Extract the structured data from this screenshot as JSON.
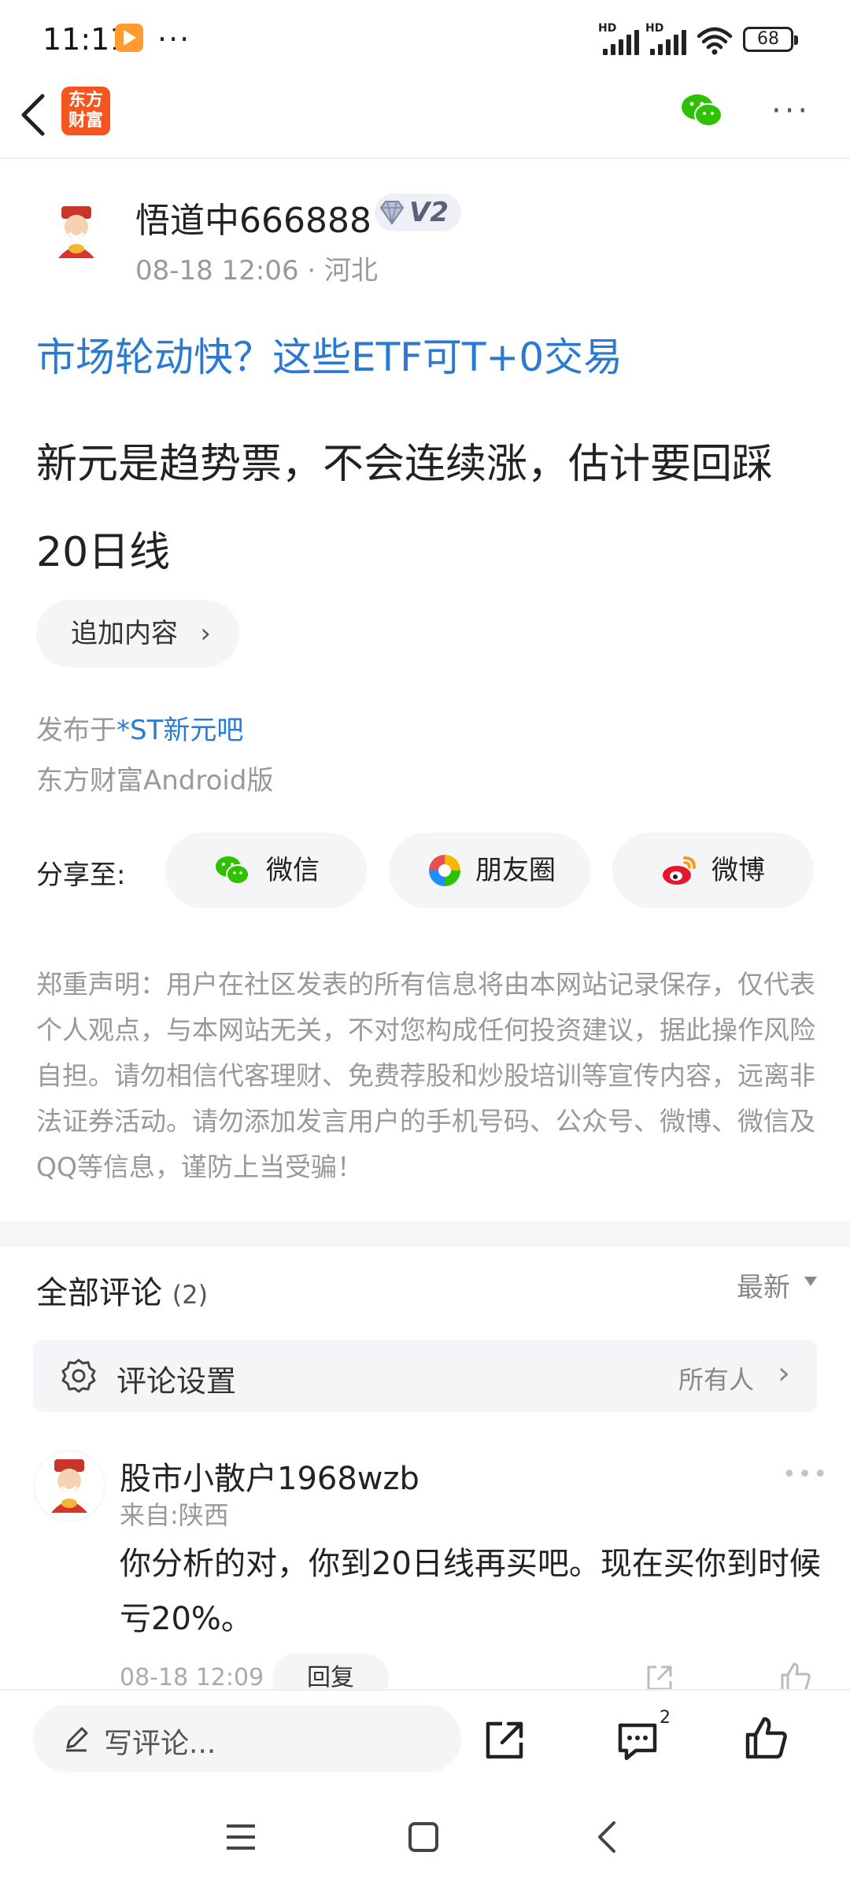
{
  "status_bar": {
    "time": "11:11",
    "overflow_dots": "···",
    "hd1": "HD",
    "hd2": "HD",
    "battery": "68"
  },
  "nav": {
    "logo_line1": "东方",
    "logo_line2": "财富",
    "more": "···"
  },
  "post": {
    "author": "悟道中666888",
    "badge": "V2",
    "meta": "08-18 12:06 · 河北",
    "title": "市场轮动快？这些ETF可T+0交易",
    "content": "新元是趋势票，不会连续涨，估计要回踩20日线",
    "append_label": "追加内容",
    "published_prefix": "发布于",
    "board": "*ST新元吧",
    "client": "东方财富Android版"
  },
  "share": {
    "label": "分享至:",
    "wechat": "微信",
    "moments": "朋友圈",
    "weibo": "微博"
  },
  "disclaimer": "郑重声明：用户在社区发表的所有信息将由本网站记录保存，仅代表个人观点，与本网站无关，不对您构成任何投资建议，据此操作风险自担。请勿相信代客理财、免费荐股和炒股培训等宣传内容，远离非法证券活动。请勿添加发言用户的手机号码、公众号、微博、微信及QQ等信息，谨防上当受骗！",
  "comments": {
    "title": "全部评论",
    "count": "(2)",
    "sort": "最新",
    "settings_label": "评论设置",
    "settings_value": "所有人",
    "items": [
      {
        "name": "股市小散户1968wzb",
        "location": "来自:陕西",
        "text": "你分析的对，你到20日线再买吧。现在买你到时候亏20%。",
        "time": "08-18 12:09",
        "reply": "回复"
      }
    ]
  },
  "action_bar": {
    "placeholder": "写评论...",
    "comment_badge": "2"
  },
  "colors": {
    "link": "#2a7ad3",
    "brand": "#f5561f",
    "wechat_green": "#2dc100",
    "weibo_red": "#e6162d"
  }
}
